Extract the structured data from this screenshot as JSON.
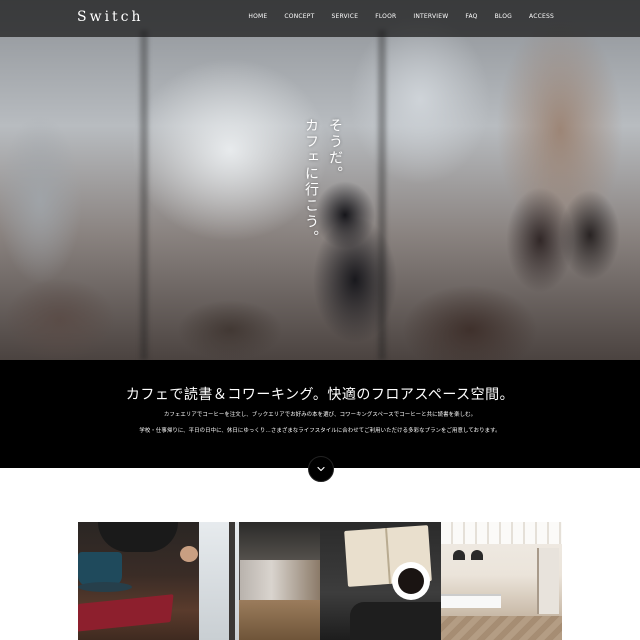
{
  "header": {
    "logo": "Switch",
    "nav": [
      "HOME",
      "CONCEPT",
      "SERVICE",
      "FLOOR",
      "INTERVIEW",
      "FAQ",
      "BLOG",
      "ACCESS"
    ]
  },
  "hero": {
    "tagline_lines": [
      "そうだ。",
      "カフェに行こう。"
    ]
  },
  "intro": {
    "title": "カフェで読書＆コワーキング。快適のフロアスペース空間。",
    "line1": "カフェエリアでコーヒーを注文し、ブックエリアでお好みの本を選び、コワーキングスペースでコーヒーと共に読書を楽しむ。",
    "line2": "学校・仕事帰りに、平日の日中に、休日にゆっくり…さまざまなライフスタイルに合わせてご利用いただける多彩なプランをご用意しております。"
  },
  "scroll_icon": "chevron-down-icon",
  "colors": {
    "band": "#000000",
    "nav_bg": "#191919",
    "text": "#ffffff"
  }
}
